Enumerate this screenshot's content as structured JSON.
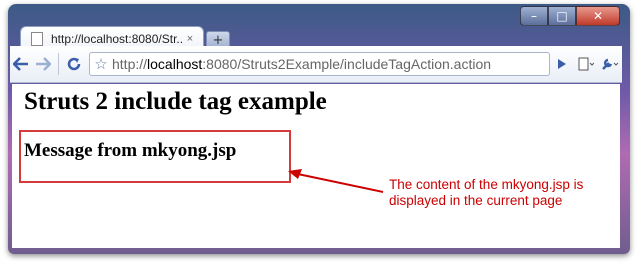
{
  "browser": {
    "tab_title": "http://localhost:8080/Str...",
    "tab_close_glyph": "×",
    "new_tab_glyph": "+",
    "address": {
      "protocol": "http://",
      "host": "localhost",
      "rest": ":8080/Struts2Example/includeTagAction.action"
    },
    "window_controls": {
      "minimize": "–",
      "maximize": "□",
      "close": "✕"
    },
    "icons": {
      "back": "back-arrow-icon",
      "forward": "forward-arrow-icon",
      "reload": "reload-icon",
      "star": "star-icon",
      "go": "go-arrow-icon",
      "page_menu": "page-icon",
      "wrench_menu": "wrench-icon"
    }
  },
  "page": {
    "heading": "Struts 2 include tag example",
    "included_message": "Message from mkyong.jsp",
    "annotation_line1": "The content of the mkyong.jsp is",
    "annotation_line2": "displayed in the current page"
  },
  "colors": {
    "annotation": "#cc0000",
    "box": "#d63b3b"
  }
}
